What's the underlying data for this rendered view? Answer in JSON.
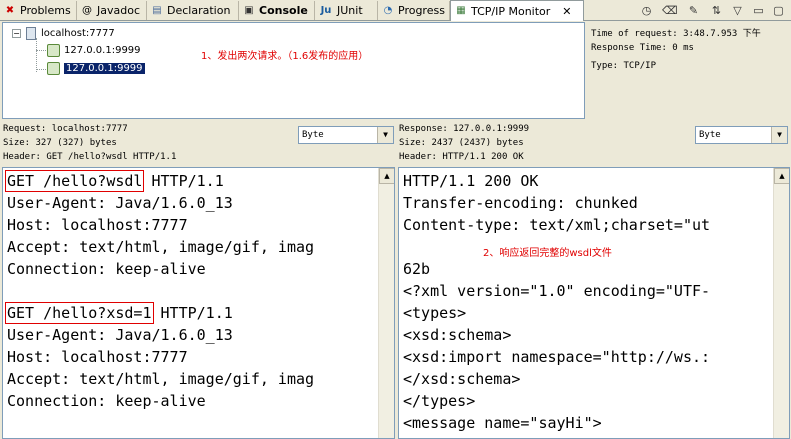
{
  "tabs": [
    {
      "label": "Problems",
      "icon": "problems-icon",
      "glyph": "✖"
    },
    {
      "label": "Javadoc",
      "icon": "javadoc-icon",
      "glyph": "@"
    },
    {
      "label": "Declaration",
      "icon": "declaration-icon",
      "glyph": "▤"
    },
    {
      "label": "Console",
      "icon": "console-icon",
      "glyph": "▣"
    },
    {
      "label": "JUnit",
      "icon": "junit-icon",
      "glyph": "Ju"
    },
    {
      "label": "Progress",
      "icon": "progress-icon",
      "glyph": "◔"
    },
    {
      "label": "TCP/IP Monitor",
      "icon": "tcpip-monitor-icon",
      "glyph": "▦"
    }
  ],
  "tree": {
    "root": "localhost:7777",
    "children": [
      "127.0.0.1:9999",
      "127.0.0.1:9999"
    ],
    "annotation": "1、发出两次请求。（1.6发布的应用）"
  },
  "info": {
    "time": "Time of request: 3:48.7.953 下午",
    "response_time": "Response Time: 0 ms",
    "type": "Type: TCP/IP"
  },
  "request": {
    "title": "Request: localhost:7777",
    "size": "Size: 327 (327) bytes",
    "header": "Header: GET /hello?wsdl HTTP/1.1",
    "encoding": "Byte",
    "lines": [
      {
        "boxed": "GET /hello?wsdl",
        "rest": " HTTP/1.1"
      },
      {
        "text": "User-Agent: Java/1.6.0_13"
      },
      {
        "text": "Host: localhost:7777"
      },
      {
        "text": "Accept: text/html, image/gif, imag"
      },
      {
        "text": "Connection: keep-alive"
      },
      {
        "text": ""
      },
      {
        "boxed": "GET /hello?xsd=1",
        "rest": " HTTP/1.1"
      },
      {
        "text": "User-Agent: Java/1.6.0_13"
      },
      {
        "text": "Host: localhost:7777"
      },
      {
        "text": "Accept: text/html, image/gif, imag"
      },
      {
        "text": "Connection: keep-alive"
      }
    ]
  },
  "response": {
    "title": "Response: 127.0.0.1:9999",
    "size": "Size: 2437 (2437) bytes",
    "header": "Header: HTTP/1.1 200 OK",
    "encoding": "Byte",
    "annotation": "2、响应返回完整的wsdl文件",
    "lines": [
      "HTTP/1.1 200 OK",
      "Transfer-encoding: chunked",
      "Content-type: text/xml;charset=\"ut",
      "",
      "62b",
      "<?xml version=\"1.0\" encoding=\"UTF-",
      "<types>",
      "<xsd:schema>",
      "<xsd:import namespace=\"http://ws.:",
      "</xsd:schema>",
      "</types>",
      "<message name=\"sayHi\">"
    ]
  },
  "colors": {
    "annotation": "#e00000",
    "selection": "#0a246a"
  }
}
